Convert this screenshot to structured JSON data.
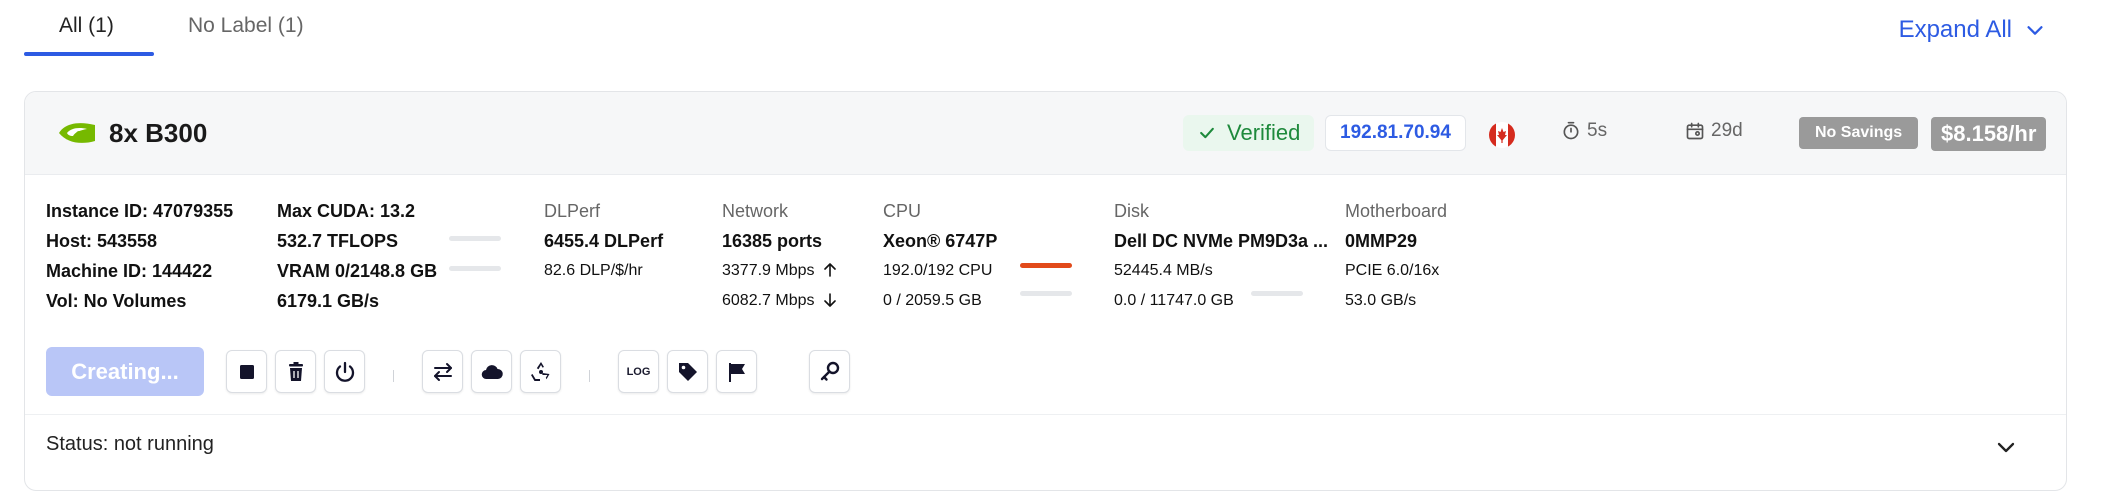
{
  "tabs": [
    {
      "label": "All (1)",
      "active": true
    },
    {
      "label": "No Label (1)",
      "active": false
    }
  ],
  "expand_all": "Expand All",
  "instance": {
    "gpu_name": "8x B300",
    "verified": "Verified",
    "ip": "192.81.70.94",
    "country_flag": "canada-flag-icon",
    "duration": "5s",
    "age": "29d",
    "savings": "No Savings",
    "price": "$8.158/hr",
    "ids": {
      "instance_id": "Instance ID: 47079355",
      "host": "Host: 543558",
      "machine_id": "Machine ID: 144422",
      "vol": "Vol: No Volumes"
    },
    "gpu": {
      "max_cuda": "Max CUDA: 13.2",
      "tflops": "532.7 TFLOPS",
      "vram": "VRAM 0/2148.8 GB",
      "bandwidth": "6179.1 GB/s"
    },
    "dlperf": {
      "label": "DLPerf",
      "value": "6455.4 DLPerf",
      "per_dollar": "82.6 DLP/$/hr"
    },
    "network": {
      "label": "Network",
      "ports": "16385 ports",
      "up": "3377.9 Mbps",
      "down": "6082.7 Mbps"
    },
    "cpu": {
      "label": "CPU",
      "model": "Xeon® 6747P",
      "cores": "192.0/192 CPU",
      "cores_fraction": 1.0,
      "ram": "0 / 2059.5 GB",
      "ram_fraction": 0.0
    },
    "disk": {
      "label": "Disk",
      "model": "Dell DC NVMe PM9D3a ...",
      "speed": "52445.4 MB/s",
      "usage": "0.0 / 11747.0 GB",
      "usage_fraction": 0.0
    },
    "motherboard": {
      "label": "Motherboard",
      "model": "0MMP29",
      "pcie": "PCIE 6.0/16x",
      "bandwidth": "53.0 GB/s"
    },
    "actions": {
      "primary": "Creating...",
      "log_label": "LOG",
      "icons": [
        "stop-icon",
        "delete-icon",
        "power-icon",
        "transfer-icon",
        "cloud-icon",
        "recycle-icon",
        "log-icon",
        "tag-icon",
        "flag-icon",
        "key-icon"
      ]
    },
    "status": "Status: not running"
  },
  "colors": {
    "accent": "#2d5be3",
    "verified_green": "#1e8a3c",
    "cpu_bar": "#e24a1a",
    "creating_button": "#b9c6f7",
    "price_badge": "#9a9a9a"
  }
}
